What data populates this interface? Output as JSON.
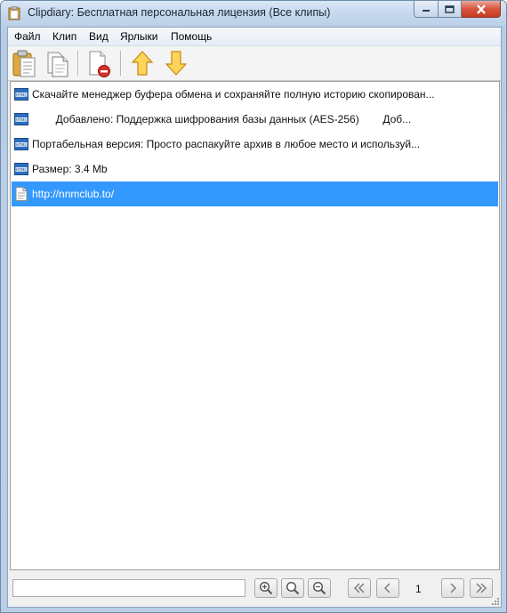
{
  "window": {
    "title": "Clipdiary: Бесплатная персональная лицензия (Все клипы)"
  },
  "menu": {
    "items": [
      "Файл",
      "Клип",
      "Вид",
      "Ярлыки",
      "Помощь"
    ]
  },
  "toolbar": {
    "buttons": [
      {
        "icon": "clipboard-paste-icon"
      },
      {
        "icon": "copy-document-icon"
      },
      {
        "icon": "delete-clip-icon"
      },
      {
        "icon": "arrow-up-icon"
      },
      {
        "icon": "arrow-down-icon"
      }
    ]
  },
  "clips": [
    {
      "type": "html",
      "icon": "html-clip-icon",
      "text": "Скачайте менеджер буфера обмена и сохраняйте полную историю скопирован..."
    },
    {
      "type": "html",
      "icon": "html-clip-icon",
      "text": "        Добавлено: Поддержка шифрования базы данных (AES-256)        Доб..."
    },
    {
      "type": "html",
      "icon": "html-clip-icon",
      "text": "Портабельная версия: Просто распакуйте архив в любое место и используй..."
    },
    {
      "type": "html",
      "icon": "html-clip-icon",
      "text": "Размер: 3.4 Mb"
    },
    {
      "type": "text",
      "icon": "text-clip-icon",
      "text": "http://nnmclub.to/",
      "selected": true
    }
  ],
  "search": {
    "value": "",
    "placeholder": ""
  },
  "pager": {
    "page": "1"
  },
  "colors": {
    "selection": "#3399ff",
    "title_bar": "#c3d6ec",
    "close_button": "#c43c22"
  }
}
